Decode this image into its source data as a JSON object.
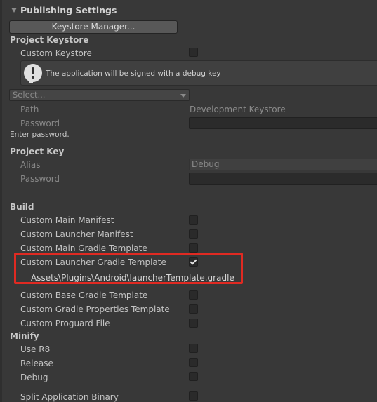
{
  "header": {
    "title": "Publishing Settings"
  },
  "keystore_manager": {
    "label": "Keystore Manager..."
  },
  "project_keystore": {
    "heading": "Project Keystore",
    "custom_keystore_label": "Custom Keystore",
    "help_text": "The application will be signed with a debug key",
    "select_placeholder": "Select...",
    "path_label": "Path",
    "path_value": "Development Keystore",
    "password_label": "Password",
    "password_note": "Enter password."
  },
  "project_key": {
    "heading": "Project Key",
    "alias_label": "Alias",
    "alias_value": "Debug",
    "password_label": "Password"
  },
  "build": {
    "heading": "Build",
    "custom_main_manifest": "Custom Main Manifest",
    "custom_launcher_manifest": "Custom Launcher Manifest",
    "custom_main_gradle_template": "Custom Main Gradle Template",
    "custom_launcher_gradle_template": "Custom Launcher Gradle Template",
    "launcher_template_path": "Assets\\Plugins\\Android\\launcherTemplate.gradle",
    "custom_base_gradle_template": "Custom Base Gradle Template",
    "custom_gradle_properties_template": "Custom Gradle Properties Template",
    "custom_proguard_file": "Custom Proguard File"
  },
  "minify": {
    "heading": "Minify",
    "use_r8": "Use R8",
    "release": "Release",
    "debug": "Debug"
  },
  "split_application_binary": {
    "label": "Split Application Binary"
  },
  "colors": {
    "highlight": "#e02a22",
    "background": "#383838"
  }
}
